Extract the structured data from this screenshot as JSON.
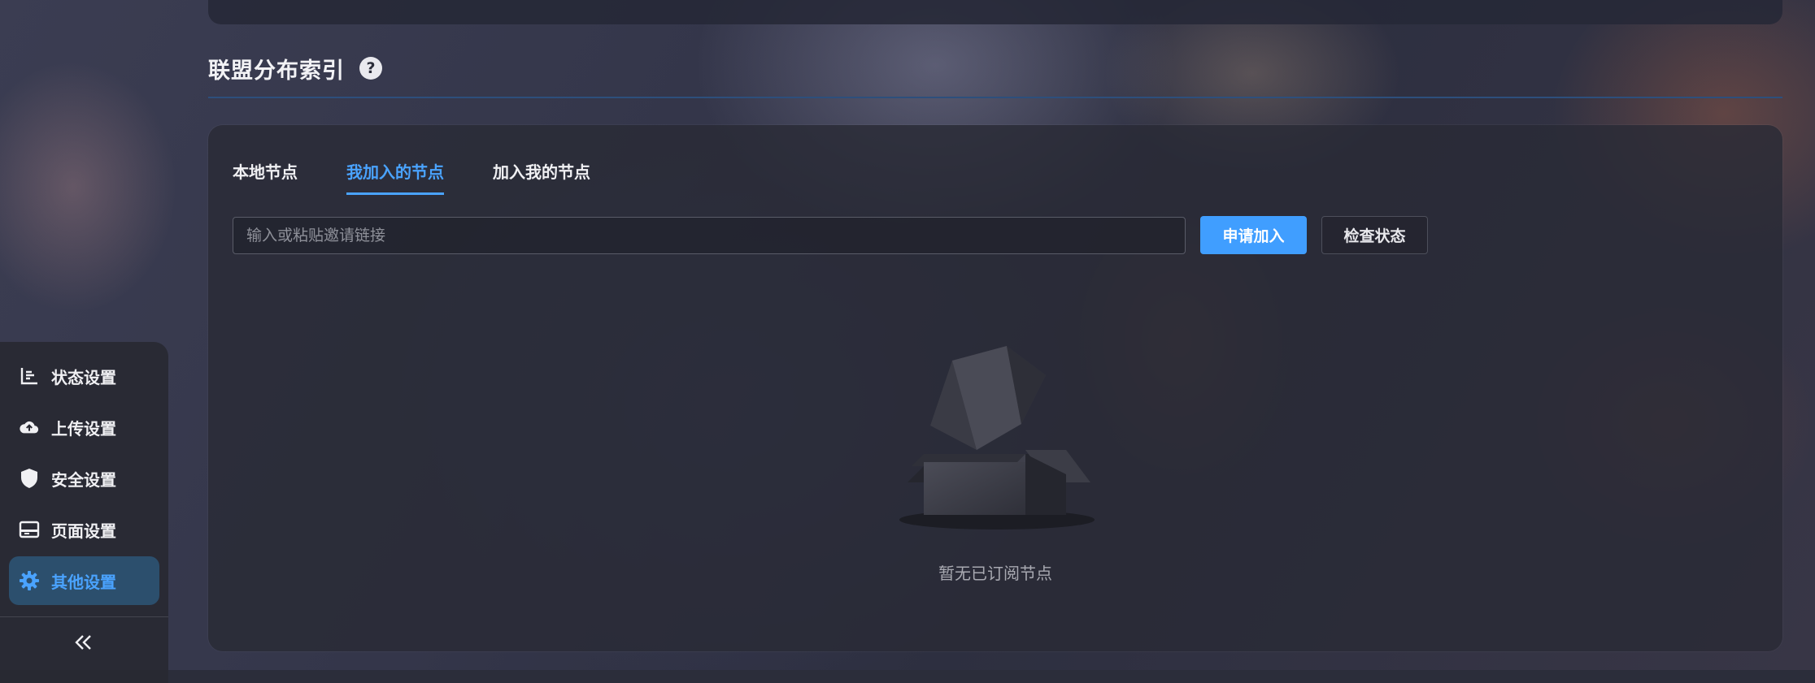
{
  "section": {
    "title": "联盟分布索引",
    "help_icon": "question-circle-icon"
  },
  "tabs": [
    {
      "label": "本地节点",
      "active": false
    },
    {
      "label": "我加入的节点",
      "active": true
    },
    {
      "label": "加入我的节点",
      "active": false
    }
  ],
  "invite": {
    "placeholder": "输入或粘贴邀请链接",
    "value": "",
    "apply_label": "申请加入",
    "check_label": "检查状态"
  },
  "empty_state": {
    "icon": "empty-box-icon",
    "text": "暂无已订阅节点"
  },
  "sidebar": {
    "items": [
      {
        "label": "状态设置",
        "icon": "chart-icon",
        "active": false
      },
      {
        "label": "上传设置",
        "icon": "cloud-upload-icon",
        "active": false
      },
      {
        "label": "安全设置",
        "icon": "shield-icon",
        "active": false
      },
      {
        "label": "页面设置",
        "icon": "card-icon",
        "active": false
      },
      {
        "label": "其他设置",
        "icon": "gear-icon",
        "active": true
      }
    ],
    "collapse_icon": "double-chevron-left-icon"
  },
  "colors": {
    "accent": "#409eff",
    "active_text": "#4aa3ff",
    "sidebar_active_bg": "#2c4f6d"
  }
}
